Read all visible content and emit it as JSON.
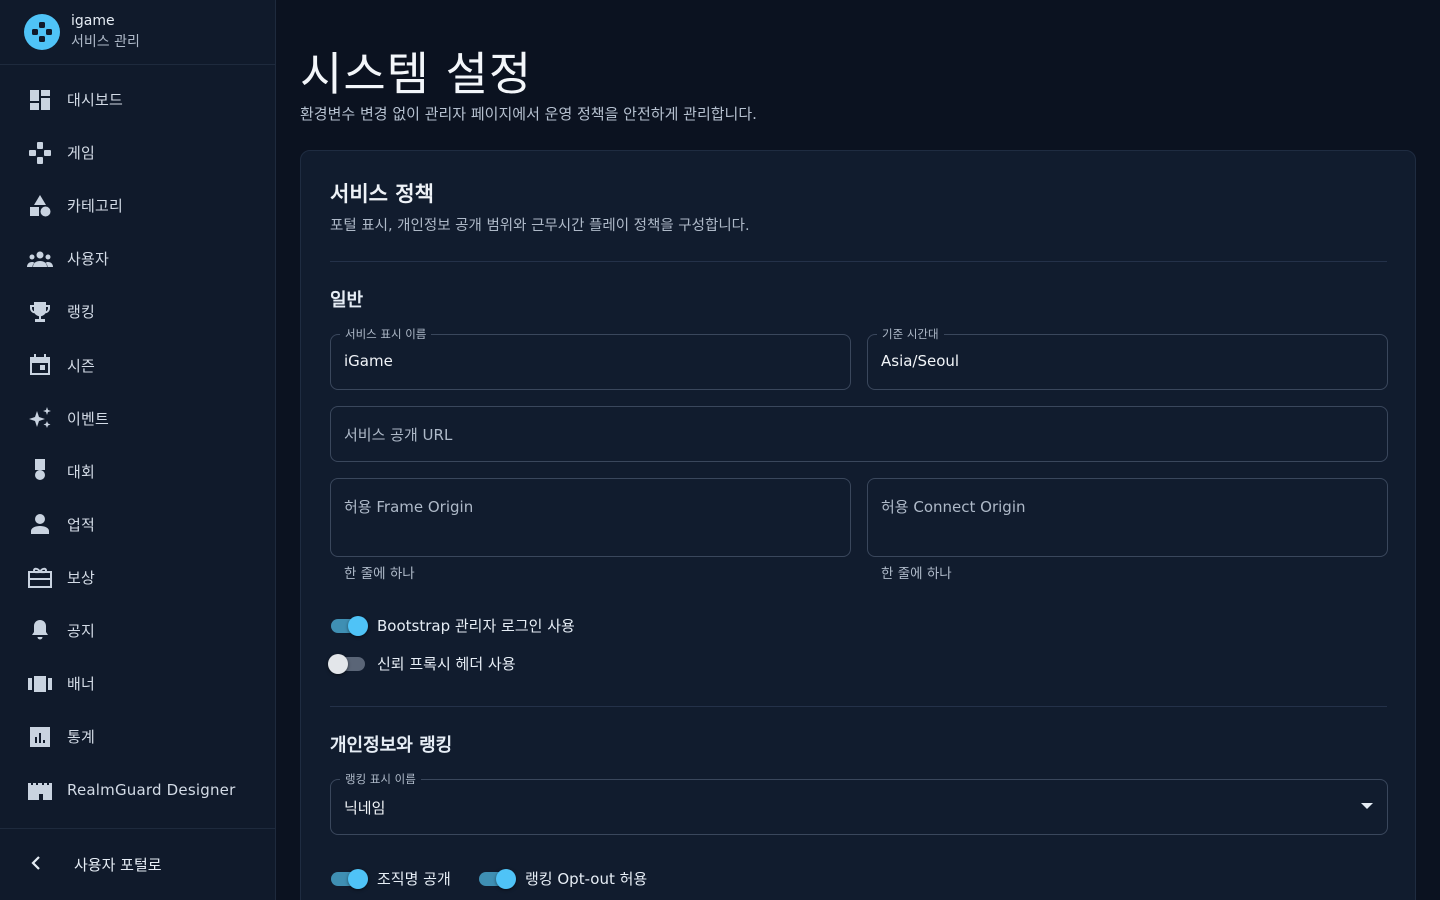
{
  "brand": {
    "name": "igame",
    "subtitle": "서비스 관리"
  },
  "sidebar": {
    "items": [
      {
        "label": "대시보드",
        "icon": "dashboard-icon"
      },
      {
        "label": "게임",
        "icon": "gamepad-icon"
      },
      {
        "label": "카테고리",
        "icon": "category-icon"
      },
      {
        "label": "사용자",
        "icon": "users-icon"
      },
      {
        "label": "랭킹",
        "icon": "trophy-icon"
      },
      {
        "label": "시즌",
        "icon": "calendar-icon"
      },
      {
        "label": "이벤트",
        "icon": "sparkle-icon"
      },
      {
        "label": "대회",
        "icon": "medal-icon"
      },
      {
        "label": "업적",
        "icon": "achievement-icon"
      },
      {
        "label": "보상",
        "icon": "gift-icon"
      },
      {
        "label": "공지",
        "icon": "bell-icon"
      },
      {
        "label": "배너",
        "icon": "banner-icon"
      },
      {
        "label": "통계",
        "icon": "stats-icon"
      },
      {
        "label": "RealmGuard Designer",
        "icon": "castle-icon"
      }
    ],
    "footer": {
      "label": "사용자 포털로",
      "icon": "chevron-left-icon"
    }
  },
  "page": {
    "title": "시스템 설정",
    "description": "환경변수 변경 없이 관리자 페이지에서 운영 정책을 안전하게 관리합니다."
  },
  "card": {
    "title": "서비스 정책",
    "description": "포털 표시, 개인정보 공개 범위와 근무시간 플레이 정책을 구성합니다."
  },
  "general": {
    "title": "일반",
    "service_name": {
      "label": "서비스 표시 이름",
      "value": "iGame"
    },
    "timezone": {
      "label": "기준 시간대",
      "value": "Asia/Seoul"
    },
    "public_url": {
      "placeholder": "서비스 공개 URL"
    },
    "frame_origin": {
      "placeholder": "허용 Frame Origin",
      "helper": "한 줄에 하나"
    },
    "connect_origin": {
      "placeholder": "허용 Connect Origin",
      "helper": "한 줄에 하나"
    },
    "bootstrap_login": {
      "label": "Bootstrap 관리자 로그인 사용",
      "enabled": true
    },
    "trusted_proxy": {
      "label": "신뢰 프록시 헤더 사용",
      "enabled": false
    }
  },
  "privacy": {
    "title": "개인정보와 랭킹",
    "ranking_display": {
      "label": "랭킹 표시 이름",
      "value": "닉네임"
    },
    "org_public": {
      "label": "조직명 공개",
      "enabled": true
    },
    "ranking_optout": {
      "label": "랭킹 Opt-out 허용",
      "enabled": true
    }
  },
  "colors": {
    "accent": "#4fc3f7",
    "background": "#0b1220",
    "surface": "#111c2e"
  }
}
